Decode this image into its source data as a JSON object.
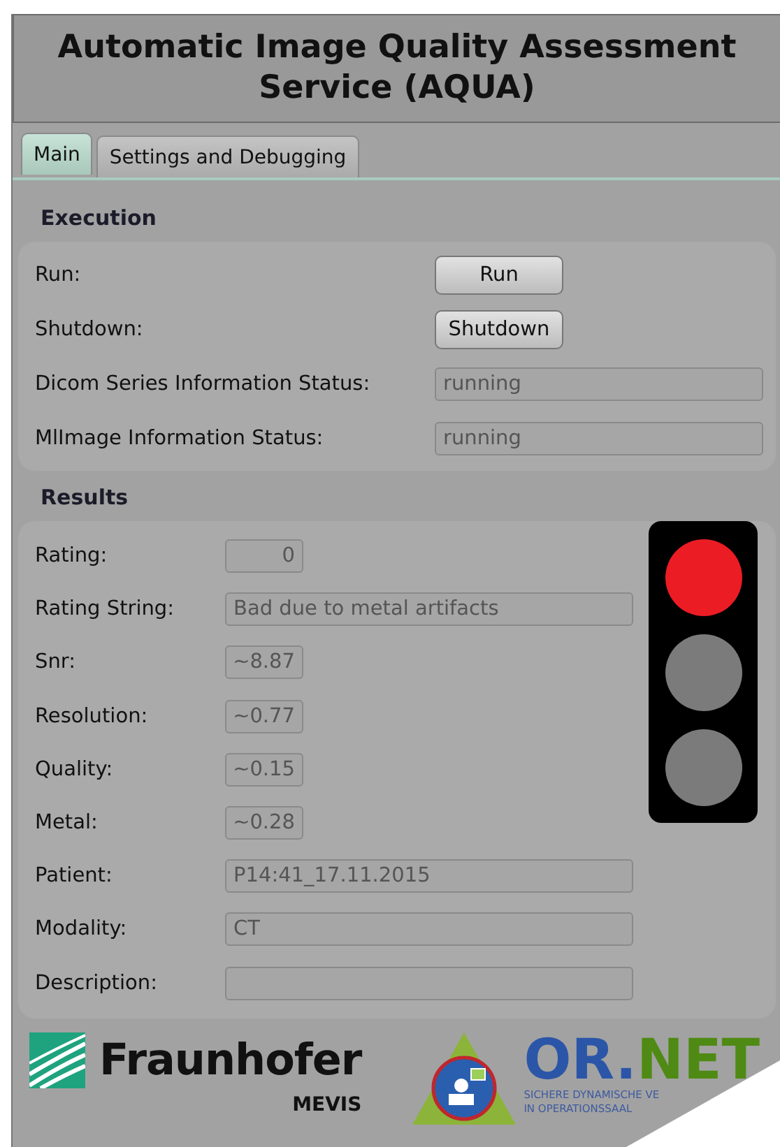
{
  "window": {
    "title": "Automatic Image Quality Assessment Service (AQUA)"
  },
  "tabs": [
    {
      "label": "Main",
      "selected": true
    },
    {
      "label": "Settings and Debugging",
      "selected": false
    }
  ],
  "execution": {
    "title": "Execution",
    "rows": [
      {
        "label": "Run:",
        "kind": "button",
        "value": "Run"
      },
      {
        "label": "Shutdown:",
        "kind": "button",
        "value": "Shutdown"
      },
      {
        "label": "Dicom Series Information Status:",
        "kind": "field",
        "value": "running"
      },
      {
        "label": "MlImage Information Status:",
        "kind": "field",
        "value": "running"
      }
    ]
  },
  "results": {
    "title": "Results",
    "rows": [
      {
        "label": "Rating:",
        "kind": "number",
        "value": "0"
      },
      {
        "label": "Rating String:",
        "kind": "text",
        "value": "Bad due to metal artifacts"
      },
      {
        "label": "Snr:",
        "kind": "number",
        "value": "~8.87"
      },
      {
        "label": "Resolution:",
        "kind": "number",
        "value": "~0.77"
      },
      {
        "label": "Quality:",
        "kind": "number",
        "value": "~0.15"
      },
      {
        "label": "Metal:",
        "kind": "number",
        "value": "~0.28"
      },
      {
        "label": "Patient:",
        "kind": "text",
        "value": "P14:41_17.11.2015"
      },
      {
        "label": "Modality:",
        "kind": "text",
        "value": "CT"
      },
      {
        "label": "Description:",
        "kind": "text"
      }
    ],
    "traffic_light": [
      {
        "color": "#ec1c24"
      },
      {
        "color": "#7b7b7b"
      },
      {
        "color": "#7b7b7b"
      }
    ]
  },
  "footer": {
    "fraunhofer": "Fraunhofer",
    "mevis": "MEVIS",
    "ornet_first": "OR.",
    "ornet_second": "NET",
    "ornet_line_1": "SICHERE DYNAMISCHE VE",
    "ornet_line_2": "IN OPERATIONSSAAL"
  }
}
